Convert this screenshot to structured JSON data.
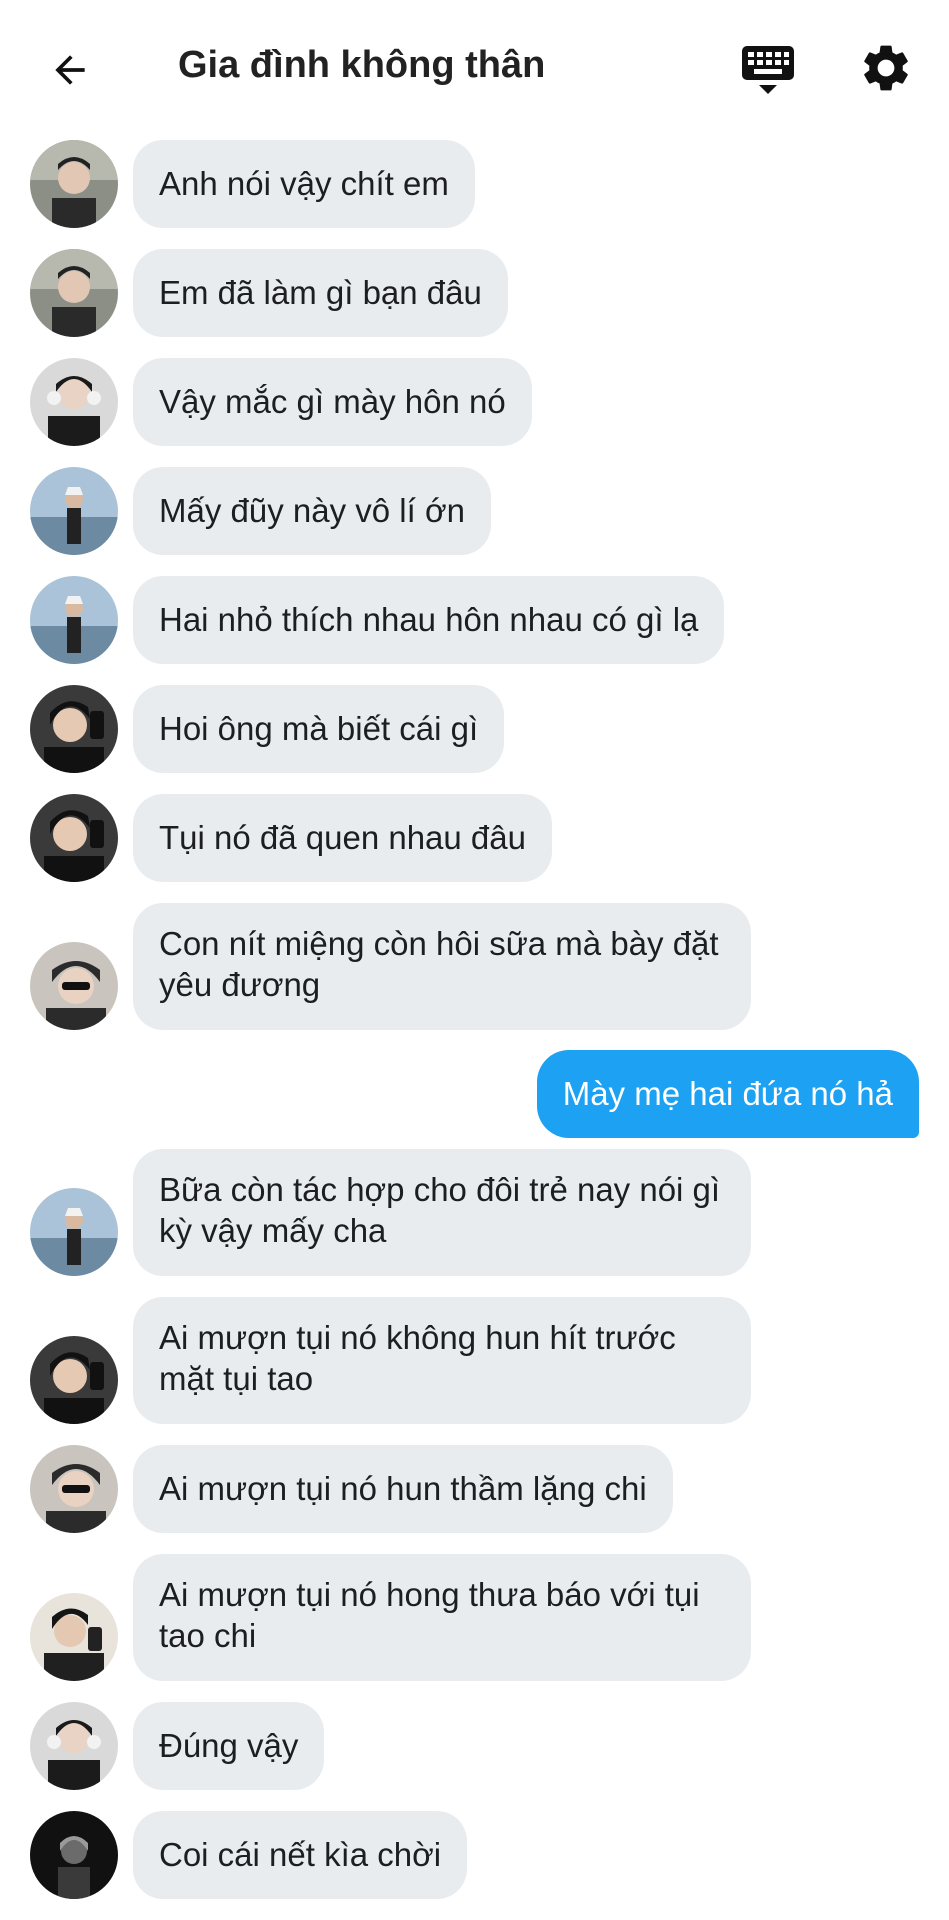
{
  "header": {
    "title": "Gia đình không thân",
    "back_icon": "arrow-left-icon",
    "keyboard_icon": "keyboard-icon",
    "settings_icon": "gear-icon"
  },
  "colors": {
    "incoming_bubble": "#e9ecef",
    "outgoing_bubble": "#1da1f2"
  },
  "messages": [
    {
      "sender": "avatar-a",
      "text": "Anh nói vậy chít em"
    },
    {
      "sender": "avatar-a",
      "text": "Em đã làm gì bạn đâu"
    },
    {
      "sender": "avatar-b",
      "text": "Vậy mắc gì mày hôn nó"
    },
    {
      "sender": "avatar-c",
      "text": "Mấy đũy này vô lí ớn"
    },
    {
      "sender": "avatar-c",
      "text": "Hai nhỏ thích nhau hôn nhau có gì lạ"
    },
    {
      "sender": "avatar-d",
      "text": "Hoi ông mà biết cái gì"
    },
    {
      "sender": "avatar-d",
      "text": "Tụi nó đã quen nhau đâu"
    },
    {
      "sender": "avatar-e",
      "text": "Con nít miệng còn hôi sữa mà bày đặt yêu đương"
    },
    {
      "sender": "me",
      "text": "Mày mẹ hai đứa nó hả"
    },
    {
      "sender": "avatar-c",
      "text": "Bữa còn tác hợp cho đôi trẻ nay nói gì kỳ vậy mấy cha"
    },
    {
      "sender": "avatar-d",
      "text": "Ai mượn tụi nó không hun hít trước mặt tụi tao"
    },
    {
      "sender": "avatar-e",
      "text": "Ai mượn tụi nó hun thầm lặng chi"
    },
    {
      "sender": "avatar-f",
      "text": "Ai mượn tụi nó hong thưa báo với tụi tao chi"
    },
    {
      "sender": "avatar-b",
      "text": "Đúng vậy"
    },
    {
      "sender": "avatar-g",
      "text": "Coi cái nết kìa chời"
    }
  ]
}
